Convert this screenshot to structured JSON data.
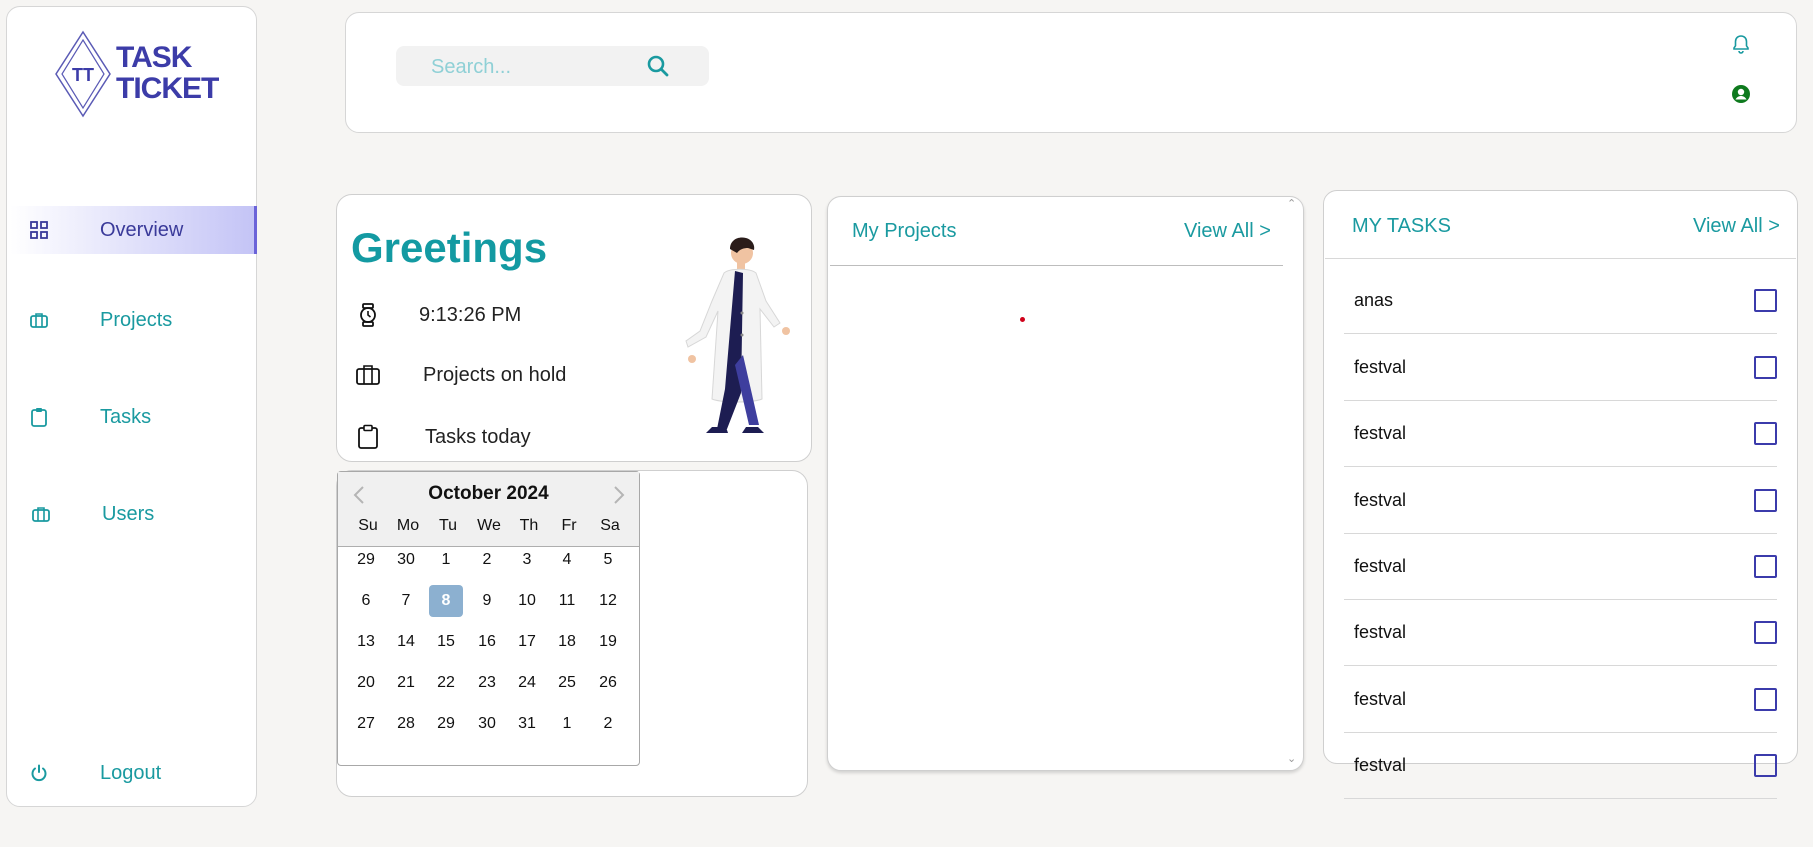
{
  "logo": {
    "initials": "TT",
    "line1": "TASK",
    "line2": "TICKET"
  },
  "sidebar": {
    "items": [
      {
        "label": "Overview",
        "icon": "grid-icon"
      },
      {
        "label": "Projects",
        "icon": "briefcase-icon"
      },
      {
        "label": "Tasks",
        "icon": "clipboard-icon"
      },
      {
        "label": "Users",
        "icon": "briefcase-icon"
      }
    ],
    "logout": "Logout"
  },
  "header": {
    "search_placeholder": "Search..."
  },
  "greetings": {
    "title": "Greetings",
    "time": "9:13:26 PM",
    "projects_on_hold": "Projects on hold",
    "tasks_today": "Tasks today"
  },
  "calendar": {
    "month": "October 2024",
    "weekdays": [
      "Su",
      "Mo",
      "Tu",
      "We",
      "Th",
      "Fr",
      "Sa"
    ],
    "weeks": [
      [
        "29",
        "30",
        "1",
        "2",
        "3",
        "4",
        "5"
      ],
      [
        "6",
        "7",
        "8",
        "9",
        "10",
        "11",
        "12"
      ],
      [
        "13",
        "14",
        "15",
        "16",
        "17",
        "18",
        "19"
      ],
      [
        "20",
        "21",
        "22",
        "23",
        "24",
        "25",
        "26"
      ],
      [
        "27",
        "28",
        "29",
        "30",
        "31",
        "1",
        "2"
      ]
    ],
    "selected": "8"
  },
  "projects": {
    "title": "My Projects",
    "view_all": "View All >"
  },
  "tasks": {
    "title": "MY TASKS",
    "view_all": "View All >",
    "items": [
      "anas",
      "festval",
      "festval",
      "festval",
      "festval",
      "festval",
      "festval",
      "festval"
    ]
  },
  "colors": {
    "accent": "#1a9aa0",
    "brand": "#3c3ca8",
    "selected_day": "#8cb0d0"
  }
}
